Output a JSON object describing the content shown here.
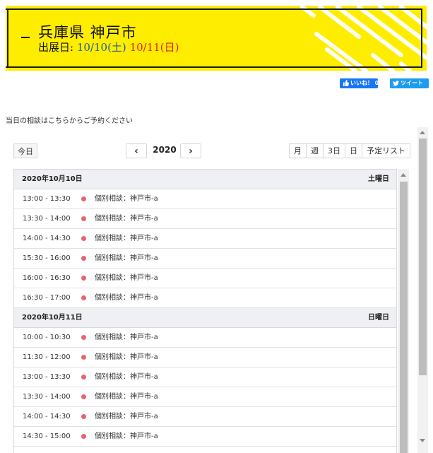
{
  "banner": {
    "title": "兵庫県 神戸市",
    "sub_label": "出展日:",
    "date1": "10/10(土)",
    "date2": "10/11(日)",
    "colors": {
      "background": "#ffed00",
      "date1": "#1f5aa0",
      "date2": "#e02020"
    }
  },
  "social": {
    "like_label": "いいね！ 0",
    "tweet_label": "ツイート"
  },
  "notice": "当日の相談はこちらからご予約ください",
  "calendar": {
    "today_label": "今日",
    "prev_icon": "‹",
    "next_icon": "›",
    "year": "2020",
    "views": [
      "月",
      "週",
      "3日",
      "日",
      "予定リスト"
    ],
    "days": [
      {
        "date": "2020年10月10日",
        "weekday": "土曜日",
        "events": [
          {
            "time": "13:00 - 13:30",
            "title": "個別相談：神戸市-a"
          },
          {
            "time": "13:30 - 14:00",
            "title": "個別相談：神戸市-a"
          },
          {
            "time": "14:00 - 14:30",
            "title": "個別相談：神戸市-a"
          },
          {
            "time": "15:30 - 16:00",
            "title": "個別相談：神戸市-a"
          },
          {
            "time": "16:00 - 16:30",
            "title": "個別相談：神戸市-a"
          },
          {
            "time": "16:30 - 17:00",
            "title": "個別相談：神戸市-a"
          }
        ]
      },
      {
        "date": "2020年10月11日",
        "weekday": "日曜日",
        "events": [
          {
            "time": "10:00 - 10:30",
            "title": "個別相談：神戸市-a"
          },
          {
            "time": "11:30 - 12:00",
            "title": "個別相談：神戸市-a"
          },
          {
            "time": "13:00 - 13:30",
            "title": "個別相談：神戸市-a"
          },
          {
            "time": "13:30 - 14:00",
            "title": "個別相談：神戸市-a"
          },
          {
            "time": "14:00 - 14:30",
            "title": "個別相談：神戸市-a"
          },
          {
            "time": "14:30 - 15:00",
            "title": "個別相談：神戸市-a"
          }
        ]
      }
    ],
    "event_dot_color": "#e8646b"
  }
}
